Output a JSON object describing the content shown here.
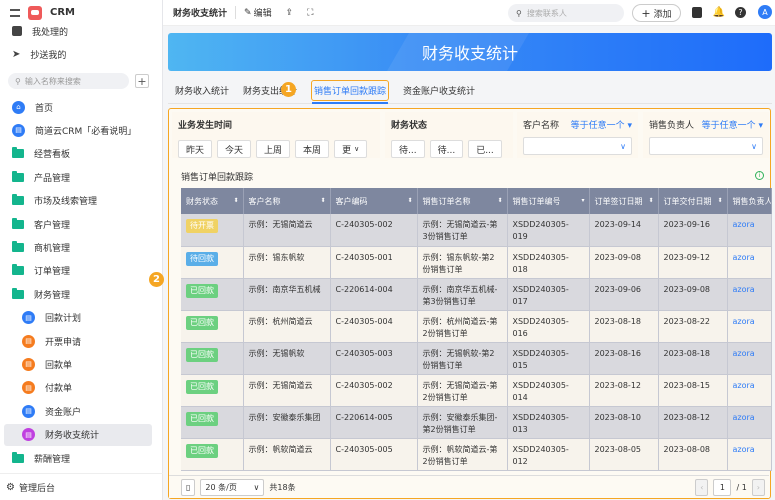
{
  "app": {
    "name": "CRM"
  },
  "sidebar": {
    "top_items": [
      {
        "label": "我处理的",
        "icon": "inbox-check-icon"
      },
      {
        "label": "抄送我的",
        "icon": "send-icon"
      }
    ],
    "search_placeholder": "输入名称来搜索",
    "items": [
      {
        "label": "首页",
        "icon": "home-icon",
        "color": "#2f7cf6",
        "sub": false
      },
      {
        "label": "简道云CRM「必看说明」",
        "icon": "doc-icon",
        "color": "#2f7cf6",
        "sub": false
      },
      {
        "label": "经营看板",
        "icon": "folder-icon",
        "sub": false
      },
      {
        "label": "产品管理",
        "icon": "folder-icon",
        "sub": false
      },
      {
        "label": "市场及线索管理",
        "icon": "folder-icon",
        "sub": false
      },
      {
        "label": "客户管理",
        "icon": "folder-icon",
        "sub": false
      },
      {
        "label": "商机管理",
        "icon": "folder-icon",
        "sub": false
      },
      {
        "label": "订单管理",
        "icon": "folder-icon",
        "sub": false
      },
      {
        "label": "财务管理",
        "icon": "folder-open-icon",
        "sub": false
      },
      {
        "label": "回款计划",
        "icon": "doc-icon",
        "color": "#2f7cf6",
        "sub": true
      },
      {
        "label": "开票申请",
        "icon": "form-icon",
        "color": "#f57c1f",
        "sub": true
      },
      {
        "label": "回款单",
        "icon": "form-icon",
        "color": "#f57c1f",
        "sub": true
      },
      {
        "label": "付款单",
        "icon": "form-icon",
        "color": "#f57c1f",
        "sub": true
      },
      {
        "label": "资金账户",
        "icon": "doc-icon",
        "color": "#2f7cf6",
        "sub": true
      },
      {
        "label": "财务收支统计",
        "icon": "dashboard-icon",
        "color": "#c040e0",
        "sub": true,
        "active": true
      },
      {
        "label": "薪酬管理",
        "icon": "folder-icon",
        "sub": false
      }
    ],
    "footer": "管理后台"
  },
  "topbar": {
    "title": "财务收支统计",
    "edit": "编辑",
    "search_placeholder": "搜索联系人",
    "add": "添加",
    "avatar": "A"
  },
  "banner": {
    "title": "财务收支统计"
  },
  "tabs": [
    {
      "label": "财务收入统计"
    },
    {
      "label": "财务支出统计"
    },
    {
      "label": "销售订单回款跟踪",
      "active": true
    },
    {
      "label": "资金账户收支统计"
    }
  ],
  "markers": [
    "1",
    "2"
  ],
  "filters": {
    "time": {
      "title": "业务发生时间",
      "buttons": [
        "昨天",
        "今天",
        "上周",
        "本周",
        "更"
      ]
    },
    "status": {
      "title": "财务状态",
      "buttons": [
        "待...",
        "待...",
        "已..."
      ]
    },
    "customer": {
      "title": "客户名称",
      "condition": "等于任意一个"
    },
    "sales": {
      "title": "销售负责人",
      "condition": "等于任意一个"
    }
  },
  "table": {
    "title": "销售订单回款跟踪",
    "columns": [
      "财务状态",
      "客户名称",
      "客户编码",
      "销售订单名称",
      "销售订单编号",
      "订单签订日期",
      "订单交付日期",
      "销售负责人"
    ],
    "status_colors": {
      "待开票": "#f0d264",
      "待回款": "#5aaee8",
      "已回款": "#6cd080"
    },
    "rows": [
      [
        "待开票",
        "示例：无锡简道云",
        "C-240305-002",
        "示例：无锡简道云-第3份销售订单",
        "XSDD240305-019",
        "2023-09-14",
        "2023-09-16",
        "azora"
      ],
      [
        "待回款",
        "示例：锡东帆软",
        "C-240305-001",
        "示例：锡东帆软-第2份销售订单",
        "XSDD240305-018",
        "2023-09-08",
        "2023-09-12",
        "azora"
      ],
      [
        "已回款",
        "示例：南京华五机械",
        "C-220614-004",
        "示例：南京华五机械-第3份销售订单",
        "XSDD240305-017",
        "2023-09-06",
        "2023-09-08",
        "azora"
      ],
      [
        "已回款",
        "示例：杭州简道云",
        "C-240305-004",
        "示例：杭州简道云-第2份销售订单",
        "XSDD240305-016",
        "2023-08-18",
        "2023-08-22",
        "azora"
      ],
      [
        "已回款",
        "示例：无锡帆软",
        "C-240305-003",
        "示例：无锡帆软-第2份销售订单",
        "XSDD240305-015",
        "2023-08-16",
        "2023-08-18",
        "azora"
      ],
      [
        "已回款",
        "示例：无锡简道云",
        "C-240305-002",
        "示例：无锡简道云-第2份销售订单",
        "XSDD240305-014",
        "2023-08-12",
        "2023-08-15",
        "azora"
      ],
      [
        "已回款",
        "示例：安徽泰乐集团",
        "C-220614-005",
        "示例：安徽泰乐集团-第2份销售订单",
        "XSDD240305-013",
        "2023-08-10",
        "2023-08-12",
        "azora"
      ],
      [
        "已回款",
        "示例：帆软简道云",
        "C-240305-005",
        "示例：帆软简道云-第2份销售订单",
        "XSDD240305-012",
        "2023-08-05",
        "2023-08-08",
        "azora"
      ]
    ]
  },
  "pager": {
    "page_size": "20 条/页",
    "total": "共18条",
    "page": "1",
    "pages": "/ 1"
  }
}
